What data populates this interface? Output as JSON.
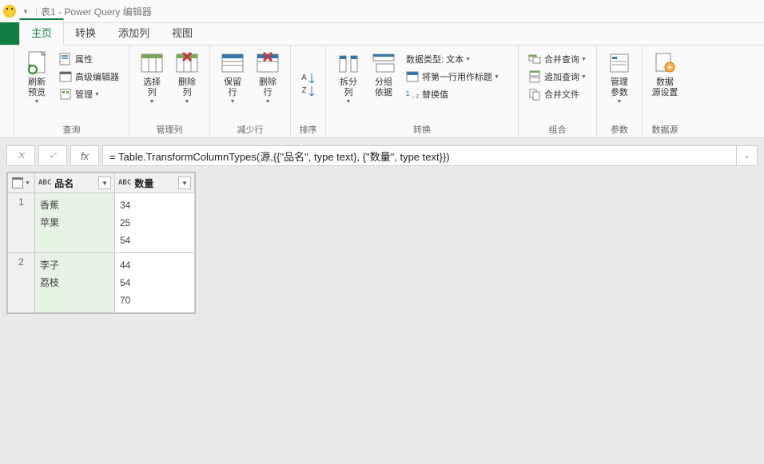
{
  "window": {
    "title": "表1 - Power Query 编辑器"
  },
  "tabs": {
    "home": "主页",
    "transform": "转换",
    "addcol": "添加列",
    "view": "视图"
  },
  "ribbon": {
    "query_group": "查询",
    "refresh": "刷新\n预览",
    "properties": "属性",
    "adv_editor": "高级编辑器",
    "manage": "管理",
    "manage_cols_group": "管理列",
    "choose_cols": "选择\n列",
    "remove_cols": "删除\n列",
    "reduce_rows_group": "减少行",
    "keep_rows": "保留\n行",
    "remove_rows": "删除\n行",
    "sort_group": "排序",
    "split_col": "拆分\n列",
    "group_by": "分组\n依据",
    "transform_group": "转换",
    "data_type": "数据类型: 文本",
    "first_row_header": "将第一行用作标题",
    "replace_values": "替换值",
    "combine_group": "组合",
    "merge_queries": "合并查询",
    "append_queries": "追加查询",
    "combine_files": "合并文件",
    "params_group": "参数",
    "manage_params": "管理\n参数",
    "ds_group": "数据源",
    "ds_settings": "数据\n源设置"
  },
  "formula": {
    "text": "= Table.TransformColumnTypes(源,{{\"品名\", type text}, {\"数量\", type text}})"
  },
  "table": {
    "columns": [
      {
        "name": "品名",
        "type": "ABC"
      },
      {
        "name": "数量",
        "type": "ABC"
      }
    ],
    "rows": [
      {
        "num": "1",
        "c0": [
          "香蕉",
          "苹果",
          ""
        ],
        "c1": [
          "34",
          "25",
          "54"
        ]
      },
      {
        "num": "2",
        "c0": [
          "李子",
          "荔枝",
          ""
        ],
        "c1": [
          "44",
          "54",
          "70"
        ]
      }
    ]
  }
}
